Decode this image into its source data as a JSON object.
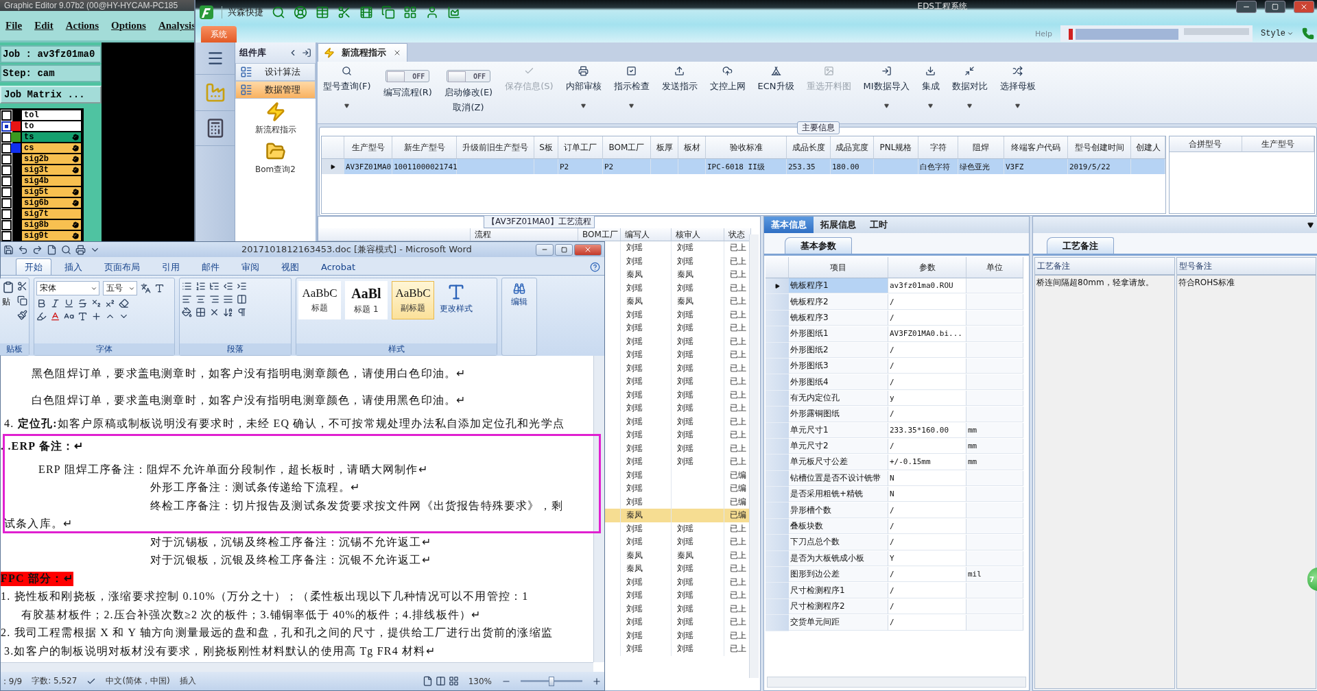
{
  "graphic_editor": {
    "title": "Graphic Editor 9.07b2 (00@HY-HYCAM-PC185",
    "menu": [
      "File",
      "Edit",
      "Actions",
      "Options",
      "Analysis"
    ],
    "job": "Job : av3fz01ma0",
    "step": "Step: cam",
    "matrix_button": "Job Matrix ...",
    "layers": [
      {
        "name": "tol",
        "color": "#ffffff",
        "flag": false,
        "selected": false
      },
      {
        "name": "to",
        "color": "#ffffff",
        "swatch": {
          "color": "#e81414"
        },
        "flag": false,
        "selected": true
      },
      {
        "name": "ts",
        "color": "#14a06e",
        "swatch": {
          "color": "#3a9a20"
        },
        "flag": true,
        "selected": false
      },
      {
        "name": "cs",
        "color": "#f8c050",
        "swatch": {
          "color": "#1030f0"
        },
        "flag": true,
        "selected": false
      },
      {
        "name": "sig2b",
        "color": "#f8c050",
        "flag": true,
        "selected": false
      },
      {
        "name": "sig3t",
        "color": "#f8c050",
        "flag": true,
        "selected": false
      },
      {
        "name": "sig4b",
        "color": "#f8c050",
        "flag": false,
        "selected": false
      },
      {
        "name": "sig5t",
        "color": "#f8c050",
        "flag": true,
        "selected": false
      },
      {
        "name": "sig6b",
        "color": "#f8c050",
        "flag": true,
        "selected": false
      },
      {
        "name": "sig7t",
        "color": "#f8c050",
        "flag": false,
        "selected": false
      },
      {
        "name": "sig8b",
        "color": "#f8c050",
        "flag": true,
        "selected": false
      },
      {
        "name": "sig9t",
        "color": "#f8c050",
        "flag": true,
        "selected": false
      }
    ]
  },
  "eds": {
    "title": "EDS工程系统",
    "quick_label": "兴森快捷",
    "menu_tab": "系统",
    "help": "Help",
    "style": "Style",
    "nav": {
      "title": "组件库",
      "items": [
        {
          "label": "设计算法",
          "selected": false
        },
        {
          "label": "数据管理",
          "selected": true
        }
      ],
      "shortcuts": [
        {
          "label": "新流程指示",
          "kind": "lightning"
        },
        {
          "label": "Bom查询2",
          "kind": "folder"
        }
      ]
    },
    "doc_tab": {
      "label": "新流程指示"
    },
    "toolbar": [
      {
        "kind": "button",
        "label": "型号查询(F)",
        "dropdown": true,
        "disabled": false
      },
      {
        "kind": "toggle",
        "label": "编写流程(R)",
        "toggle_text": "OFF",
        "on": false
      },
      {
        "kind": "toggle",
        "label": "启动修改(E)",
        "toggle_text": "OFF",
        "on": false,
        "sub_label": "取消(Z)"
      },
      {
        "kind": "button",
        "label": "保存信息(S)",
        "dropdown": false,
        "disabled": true
      },
      {
        "kind": "button",
        "label": "内部审核",
        "dropdown": true,
        "disabled": false
      },
      {
        "kind": "button",
        "label": "指示检查",
        "dropdown": true,
        "disabled": false
      },
      {
        "kind": "button",
        "label": "发送指示",
        "dropdown": false,
        "disabled": false
      },
      {
        "kind": "button",
        "label": "文控上网",
        "dropdown": false,
        "disabled": false
      },
      {
        "kind": "button",
        "label": "ECN升级",
        "dropdown": false,
        "disabled": false
      },
      {
        "kind": "button",
        "label": "重选开料图",
        "dropdown": false,
        "disabled": true
      },
      {
        "kind": "button",
        "label": "MI数据导入",
        "dropdown": true,
        "disabled": false
      },
      {
        "kind": "button",
        "label": "集成",
        "dropdown": true,
        "disabled": false
      },
      {
        "kind": "button",
        "label": "数据对比",
        "dropdown": true,
        "disabled": false
      },
      {
        "kind": "button",
        "label": "选择母板",
        "dropdown": true,
        "disabled": false
      }
    ],
    "main_info": {
      "title": "主要信息",
      "columns": [
        "生产型号",
        "新生产型号",
        "升级前旧生产型号",
        "S板",
        "订单工厂",
        "BOM工厂",
        "板厚",
        "板材",
        "验收标准",
        "成品长度",
        "成品宽度",
        "PNL规格",
        "字符",
        "阻焊",
        "终端客户代码",
        "型号创建时间",
        "创建人"
      ],
      "rows": [
        {
          "selected": true,
          "cells": [
            "AV3FZ01MA0",
            "10011000021741",
            "",
            "",
            "P2",
            "P2",
            "",
            "",
            "IPC-6018 II级",
            "253.35",
            "180.00",
            "",
            "白色字符",
            "绿色亚光",
            "V3FZ",
            "2019/5/22",
            ""
          ]
        }
      ],
      "side_columns": [
        "合拼型号",
        "生产型号"
      ]
    },
    "process": {
      "title": "【AV3FZ01MA0】工艺流程",
      "columns": [
        "流程",
        "BOM工厂",
        "编写人",
        "核审人",
        "状态"
      ],
      "rows": [
        {
          "writer": "刘瑶",
          "reviewer": "刘瑶",
          "status": "已上",
          "selected": false
        },
        {
          "writer": "刘瑶",
          "reviewer": "刘瑶",
          "status": "已上",
          "selected": false
        },
        {
          "writer": "秦凤",
          "reviewer": "秦凤",
          "status": "已上",
          "selected": false
        },
        {
          "writer": "刘瑶",
          "reviewer": "刘瑶",
          "status": "已上",
          "selected": false
        },
        {
          "writer": "秦凤",
          "reviewer": "秦凤",
          "status": "已上",
          "selected": false
        },
        {
          "writer": "刘瑶",
          "reviewer": "刘瑶",
          "status": "已上",
          "selected": false
        },
        {
          "writer": "刘瑶",
          "reviewer": "刘瑶",
          "status": "已上",
          "selected": false
        },
        {
          "writer": "刘瑶",
          "reviewer": "刘瑶",
          "status": "已上",
          "selected": false
        },
        {
          "writer": "刘瑶",
          "reviewer": "刘瑶",
          "status": "已上",
          "selected": false
        },
        {
          "writer": "刘瑶",
          "reviewer": "刘瑶",
          "status": "已上",
          "selected": false
        },
        {
          "writer": "刘瑶",
          "reviewer": "刘瑶",
          "status": "已上",
          "selected": false
        },
        {
          "writer": "刘瑶",
          "reviewer": "刘瑶",
          "status": "已上",
          "selected": false
        },
        {
          "writer": "刘瑶",
          "reviewer": "刘瑶",
          "status": "已上",
          "selected": false
        },
        {
          "writer": "刘瑶",
          "reviewer": "刘瑶",
          "status": "已上",
          "selected": false
        },
        {
          "writer": "刘瑶",
          "reviewer": "刘瑶",
          "status": "已上",
          "selected": false
        },
        {
          "writer": "刘瑶",
          "reviewer": "刘瑶",
          "status": "已上",
          "selected": false
        },
        {
          "writer": "刘瑶",
          "reviewer": "刘瑶",
          "status": "已上",
          "selected": false
        },
        {
          "writer": "刘瑶",
          "status": "已编",
          "selected": false
        },
        {
          "writer": "刘瑶",
          "status": "已编",
          "selected": false
        },
        {
          "writer": "刘瑶",
          "status": "已编",
          "selected": false
        },
        {
          "writer": "秦凤",
          "status": "已编",
          "selected": true
        },
        {
          "writer": "刘瑶",
          "reviewer": "刘瑶",
          "status": "已上",
          "selected": false
        },
        {
          "writer": "刘瑶",
          "reviewer": "刘瑶",
          "status": "已上",
          "selected": false
        },
        {
          "writer": "秦凤",
          "reviewer": "秦凤",
          "status": "已上",
          "selected": false
        },
        {
          "writer": "秦凤",
          "reviewer": "刘瑶",
          "status": "已上",
          "selected": false
        },
        {
          "writer": "刘瑶",
          "reviewer": "刘瑶",
          "status": "已上",
          "selected": false
        },
        {
          "writer": "刘瑶",
          "reviewer": "刘瑶",
          "status": "已上",
          "selected": false
        },
        {
          "writer": "刘瑶",
          "reviewer": "刘瑶",
          "status": "已上",
          "selected": false
        },
        {
          "writer": "刘瑶",
          "reviewer": "刘瑶",
          "status": "已上",
          "selected": false
        },
        {
          "writer": "刘瑶",
          "reviewer": "刘瑶",
          "status": "已上",
          "selected": false
        },
        {
          "writer": "刘瑶",
          "reviewer": "刘瑶",
          "status": "已上",
          "selected": false
        }
      ]
    },
    "detail": {
      "tabs": [
        {
          "label": "基本信息",
          "selected": true
        },
        {
          "label": "拓展信息",
          "selected": false
        },
        {
          "label": "工时",
          "selected": false
        }
      ],
      "sub_tab": "基本参数",
      "columns": [
        "项目",
        "参数",
        "单位"
      ],
      "rows": [
        {
          "item": "铣板程序1",
          "value": "av3fz01ma0.ROU",
          "selected": true
        },
        {
          "item": "铣板程序2",
          "value": "/",
          "selected": false
        },
        {
          "item": "铣板程序3",
          "value": "/",
          "selected": false
        },
        {
          "item": "外形图纸1",
          "value": "AV3FZ01MA0.bi...",
          "selected": false
        },
        {
          "item": "外形图纸2",
          "value": "/",
          "selected": false
        },
        {
          "item": "外形图纸3",
          "value": "/",
          "selected": false
        },
        {
          "item": "外形图纸4",
          "value": "/",
          "selected": false
        },
        {
          "item": "有无内定位孔",
          "value": "y",
          "selected": false
        },
        {
          "item": "外形露铜图纸",
          "value": "/",
          "selected": false
        },
        {
          "item": "单元尺寸1",
          "value": "233.35*160.00",
          "unit": "mm",
          "selected": false
        },
        {
          "item": "单元尺寸2",
          "value": "/",
          "unit": "mm",
          "selected": false
        },
        {
          "item": "单元板尺寸公差",
          "value": "+/-0.15mm",
          "unit": "mm",
          "selected": false
        },
        {
          "item": "钻槽位置是否不设计铣带",
          "value": "N",
          "selected": false
        },
        {
          "item": "是否采用粗铣+精铣",
          "value": "N",
          "selected": false
        },
        {
          "item": "异形槽个数",
          "value": "/",
          "selected": false
        },
        {
          "item": "叠板块数",
          "value": "/",
          "selected": false
        },
        {
          "item": "下刀点总个数",
          "value": "/",
          "selected": false
        },
        {
          "item": "是否为大板铣成小板",
          "value": "Y",
          "selected": false
        },
        {
          "item": "图形到边公差",
          "value": "/",
          "unit": "mil",
          "selected": false
        },
        {
          "item": "尺寸检测程序1",
          "value": "/",
          "selected": false
        },
        {
          "item": "尺寸检测程序2",
          "value": "/",
          "selected": false
        },
        {
          "item": "交货单元间距",
          "value": "/",
          "selected": false
        }
      ]
    },
    "remarks": {
      "tab": "工艺备注",
      "columns": [
        "工艺备注",
        "型号备注"
      ],
      "values": [
        "桥连间隔超80mm，轻拿请放。",
        "符合ROHS标准"
      ]
    },
    "badge": "7"
  },
  "word": {
    "title": "2017101812163453.doc [兼容模式] - Microsoft Word",
    "tabs": [
      {
        "label": "开始",
        "selected": true
      },
      {
        "label": "插入",
        "selected": false
      },
      {
        "label": "页面布局",
        "selected": false
      },
      {
        "label": "引用",
        "selected": false
      },
      {
        "label": "邮件",
        "selected": false
      },
      {
        "label": "审阅",
        "selected": false
      },
      {
        "label": "视图",
        "selected": false
      },
      {
        "label": "Acrobat",
        "selected": false
      }
    ],
    "clipboard": {
      "paste": "贴",
      "group": "贴板"
    },
    "font": {
      "name": "宋体",
      "size": "五号",
      "group": "字体"
    },
    "paragraph": {
      "group": "段落"
    },
    "styles": {
      "items": [
        {
          "sample": "AaBbC",
          "label": "标题",
          "selected": false
        },
        {
          "sample": "AaBl",
          "label": "标题 1",
          "selected": false
        },
        {
          "sample": "AaBbC",
          "label": "副标题",
          "selected": true
        }
      ],
      "change": "更改样式",
      "group": "样式"
    },
    "editing": {
      "label": "编辑"
    },
    "paragraphs": [
      {
        "kind": "para",
        "text": "黑色阻焊订单，要求盖电测章时，如客户没有指明电测章颜色，请使用白色印油。↵"
      },
      {
        "kind": "para",
        "text": "白色阻焊订单，要求盖电测章时，如客户没有指明电测章颜色，请使用黑色印油。↵"
      },
      {
        "kind": "numbered",
        "text": "4.  **定位孔:**如客户原稿或制板说明没有要求时，未经 EQ 确认，不可按常规处理办法私自添加定位孔和光学点"
      },
      {
        "kind": "heading",
        "text": ". .ERP 备注：↵"
      },
      {
        "kind": "indent",
        "text": "ERP 阻焊工序备注：阻焊不允许单面分段制作，超长板时，请晒大网制作↵"
      },
      {
        "kind": "deep",
        "text": "外形工序备注：测试条传递给下流程。↵"
      },
      {
        "kind": "deep",
        "text": "终检工序备注：切片报告及测试条发货要求按文件网《出货报告特殊要求》，剩"
      },
      {
        "kind": "flush",
        "text": "试条入库。↵"
      },
      {
        "kind": "deep",
        "text": "对于沉锡板，沉锡及终检工序备注：沉锡不允许返工↵"
      },
      {
        "kind": "deep",
        "text": "对于沉银板，沉银及终检工序备注：沉银不允许返工↵"
      },
      {
        "kind": "red",
        "text": "FPC 部分：↵"
      },
      {
        "kind": "list",
        "text": "1.   挠性板和刚挠板，涨缩要求控制  0.10%（万分之十）；（柔性板出现以下几种情况可以不用管控：1"
      },
      {
        "kind": "cont",
        "text": "有胶基材板件；2.压合补强次数≥2 次的板件；3.铺铜率低于 40%的板件；4.排线板件）↵"
      },
      {
        "kind": "list",
        "text": "2.    我司工程需根据 X 和 Y 轴方向测量最远的盘和盘，孔和孔之间的尺寸，提供给工厂进行出货前的涨缩监"
      },
      {
        "kind": "flush",
        "text": "3.如客户的制板说明对板材没有要求，刚挠板刚性材料默认的使用高 Tg FR4 材料↵"
      }
    ],
    "status": {
      "page": ": 9/9",
      "words": "字数: 5,527",
      "language": "中文(简体，中国)",
      "mode": "插入",
      "zoom": "130%",
      "zoom_slider": {
        "level": 0.5
      }
    }
  }
}
